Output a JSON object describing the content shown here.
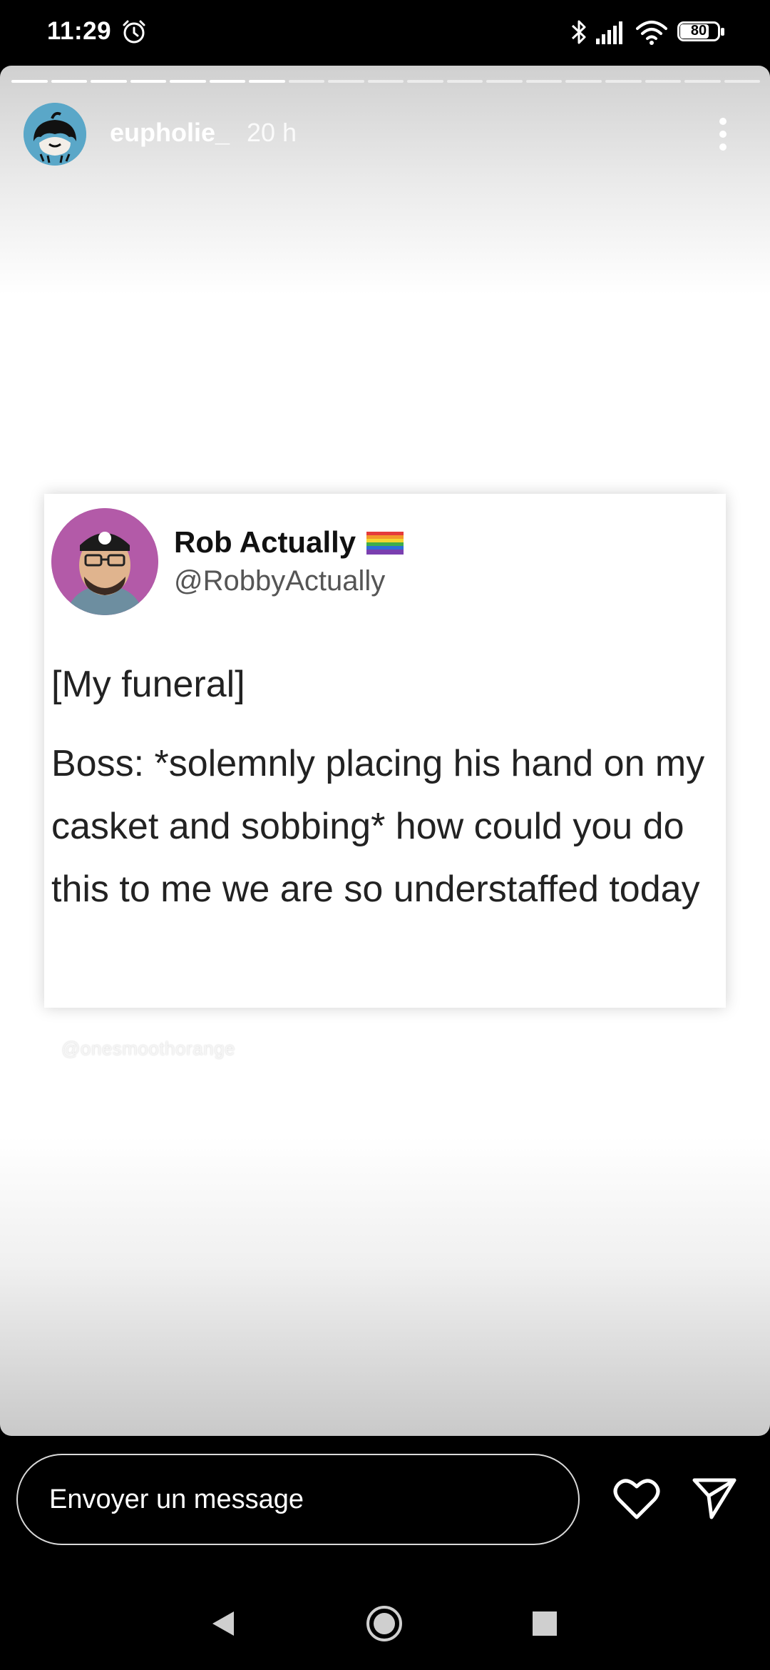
{
  "status_bar": {
    "time": "11:29",
    "battery": "80",
    "icons": [
      "alarm-icon",
      "bluetooth-icon",
      "signal-icon",
      "wifi-icon",
      "battery-icon"
    ]
  },
  "story": {
    "progress_segments_total": 19,
    "progress_segments_done": 7,
    "username": "eupholie_",
    "time_ago": "20 h",
    "menu_icon": "more-vertical-icon"
  },
  "tweet": {
    "display_name": "Rob Actually",
    "handle": "@RobbyActually",
    "line1": "[My funeral]",
    "line2": "Boss: *solemnly placing his hand on my casket and sobbing* how could you do this to me we are so understaffed today",
    "flag_icon": "rainbow-flag-icon"
  },
  "watermark": "@onesmoothorange",
  "reply": {
    "placeholder": "Envoyer un message",
    "like_icon": "heart-icon",
    "send_icon": "send-icon"
  },
  "nav": {
    "icons": [
      "back-icon",
      "home-icon",
      "recents-icon"
    ]
  }
}
